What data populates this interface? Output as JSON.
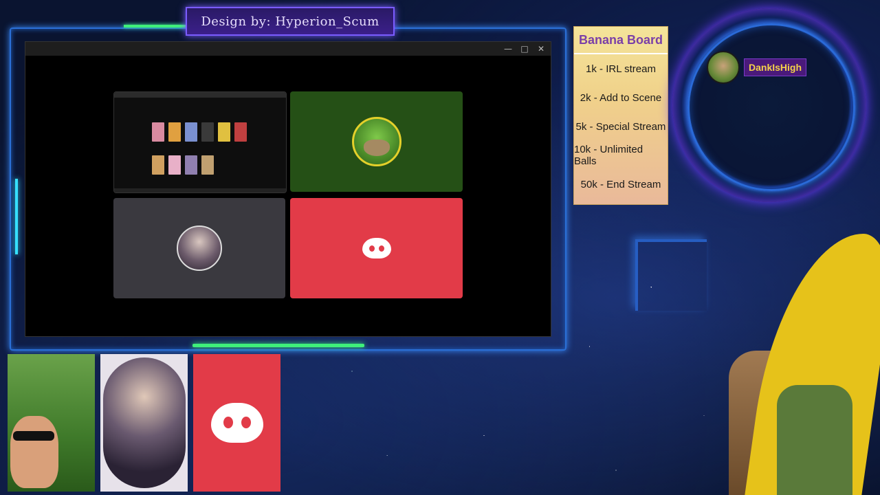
{
  "overlay": {
    "credit": "Design by: Hyperion_Scum"
  },
  "window": {
    "controls": {
      "minimize": "—",
      "maximize": "□",
      "close": "✕"
    },
    "tiles": [
      {
        "type": "screen-share"
      },
      {
        "type": "avatar",
        "icon": "pepe-avatar-icon"
      },
      {
        "type": "avatar",
        "icon": "user-avatar-icon"
      },
      {
        "type": "avatar",
        "icon": "discord-logo-icon"
      }
    ]
  },
  "banana_board": {
    "title": "Banana Board",
    "items": [
      "1k - IRL stream",
      "2k - Add to Scene",
      "5k - Special Stream",
      "10k - Unlimited Balls",
      "50k - End Stream"
    ]
  },
  "chat": {
    "user": "DankIsHigh"
  },
  "colors": {
    "discord_red": "#e23b48",
    "pepe_tile": "#255016",
    "avatar_tile": "#3a393f",
    "frame_blue": "#2a6fd6",
    "accent_green": "#3ff07a"
  }
}
